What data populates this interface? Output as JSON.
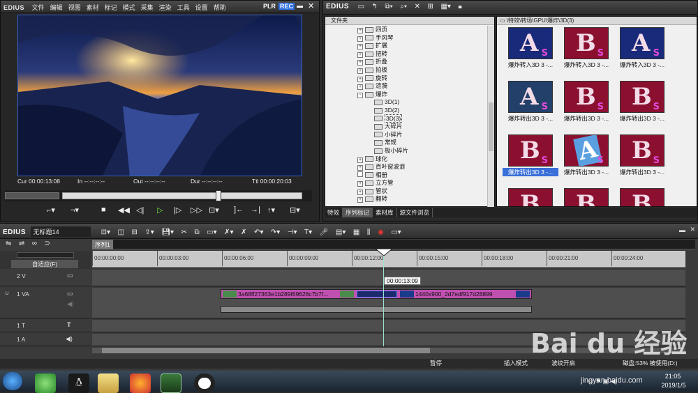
{
  "player": {
    "logo": "EDIUS",
    "menu": [
      "文件",
      "编辑",
      "视图",
      "素材",
      "标记",
      "模式",
      "采集",
      "渲染",
      "工具",
      "设置",
      "帮助"
    ],
    "plr": "PLR",
    "rec": "REC",
    "timecodes": [
      {
        "label": "Cur",
        "value": "00:00:13:08"
      },
      {
        "label": "In",
        "value": "--:--:--:--"
      },
      {
        "label": "Out",
        "value": "--:--:--:--"
      },
      {
        "label": "Dur",
        "value": "--:--:--:--"
      },
      {
        "label": "Ttl",
        "value": "00:00:20:03"
      }
    ],
    "scrub_position": 0.65
  },
  "library": {
    "logo": "EDIUS",
    "panel_title": "文件夹",
    "path": "\\特效\\转场\\GPU\\爆炸\\3D(3)",
    "tree": [
      {
        "label": "四页",
        "level": 0,
        "ex": "+"
      },
      {
        "label": "手风琴",
        "level": 0,
        "ex": "+"
      },
      {
        "label": "扩展",
        "level": 0,
        "ex": "+"
      },
      {
        "label": "扭转",
        "level": 0,
        "ex": "+"
      },
      {
        "label": "折叠",
        "level": 0,
        "ex": "+"
      },
      {
        "label": "拍板",
        "level": 0,
        "ex": "+"
      },
      {
        "label": "旋转",
        "level": 0,
        "ex": "+"
      },
      {
        "label": "涟漪",
        "level": 0,
        "ex": "+"
      },
      {
        "label": "爆炸",
        "level": 0,
        "ex": "-"
      },
      {
        "label": "3D(1)",
        "level": 1
      },
      {
        "label": "3D(2)",
        "level": 1
      },
      {
        "label": "3D(3)",
        "level": 1,
        "selected": true
      },
      {
        "label": "大碎片",
        "level": 1
      },
      {
        "label": "小碎片",
        "level": 1
      },
      {
        "label": "常规",
        "level": 1
      },
      {
        "label": "极小碎片",
        "level": 1
      },
      {
        "label": "球化",
        "level": 0,
        "ex": "+"
      },
      {
        "label": "百叶窗波浪",
        "level": 0,
        "ex": "+"
      },
      {
        "label": "相册",
        "level": 0
      },
      {
        "label": "立方管",
        "level": 0,
        "ex": "+"
      },
      {
        "label": "管状",
        "level": 0,
        "ex": "+"
      },
      {
        "label": "翻转",
        "level": 0,
        "ex": "+"
      }
    ],
    "thumbs": [
      {
        "letter": "A",
        "label": "爆炸转入3D 3 -...",
        "style": "blue"
      },
      {
        "letter": "B",
        "label": "爆炸转入3D 3 -...",
        "style": "red"
      },
      {
        "letter": "A",
        "label": "爆炸转入3D 3 -...",
        "style": "blue"
      },
      {
        "letter": "A",
        "label": "爆炸转出3D 3 -...",
        "style": "blue-frag"
      },
      {
        "letter": "B",
        "label": "爆炸转出3D 3 -...",
        "style": "red"
      },
      {
        "letter": "B",
        "label": "爆炸转出3D 3 -...",
        "style": "red"
      },
      {
        "letter": "B",
        "label": "爆炸转出3D 3 -...",
        "style": "red",
        "selected": true
      },
      {
        "letter": "A",
        "label": "爆炸转出3D 3 -...",
        "style": "blue-tilt"
      },
      {
        "letter": "B",
        "label": "爆炸转出3D 3 -...",
        "style": "red"
      },
      {
        "letter": "B",
        "label": "",
        "style": "red"
      },
      {
        "letter": "B",
        "label": "",
        "style": "red"
      },
      {
        "letter": "B",
        "label": "",
        "style": "red"
      }
    ],
    "tabs": [
      "特效",
      "序列标记",
      "素材库",
      "源文件浏览"
    ],
    "active_tab": 1
  },
  "timeline": {
    "logo": "EDIUS",
    "project": "无标题14",
    "sequence_tab": "序列1",
    "fit_label": "自适应(F)",
    "ruler": [
      "00:00:00:00",
      "00:00:03:00",
      "00:00:06:00",
      "00:00:09:00",
      "00:00:12:00",
      "00:00:15:00",
      "00:00:18:00",
      "00:00:21:00",
      "00:00:24:00"
    ],
    "cursor_tc": "00:00:13:09",
    "tracks": [
      {
        "name": "2 V"
      },
      {
        "name": "1 VA"
      },
      {
        "name": "1 T"
      },
      {
        "name": "1 A"
      }
    ],
    "clips": [
      {
        "label": "3a68ff27363e1b289f69628c7b7f..."
      },
      {
        "label": "1440x900_2d7edf917d28899"
      }
    ]
  },
  "status": {
    "pause": "暂停",
    "insert_mode": "插入模式",
    "ripple": "波纹开启",
    "disk": "磁盘:53% 被使用(D:)"
  },
  "taskbar": {
    "time": "21:05",
    "date": "2019/1/5"
  },
  "watermark": {
    "brand": "Bai du 经验",
    "url": "jingyan.baidu.com"
  }
}
